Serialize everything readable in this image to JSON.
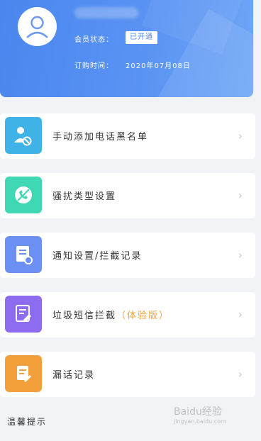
{
  "header": {
    "status_label": "会员状态：",
    "status_badge": "已开通",
    "order_label": "订购时间：",
    "order_date": "2020年07月08日"
  },
  "menu": [
    {
      "label": "手动添加电话黑名单",
      "icon": "user-block-icon",
      "color": "#3fb2e8"
    },
    {
      "label": "骚扰类型设置",
      "icon": "block-phone-icon",
      "color": "#3fd7b4"
    },
    {
      "label": "通知设置/拦截记录",
      "icon": "notify-record-icon",
      "color": "#6c8ff3"
    },
    {
      "label": "垃圾短信拦截",
      "suffix": "（体验版）",
      "icon": "sms-filter-icon",
      "color": "#8e6cf0"
    },
    {
      "label": "漏话记录",
      "icon": "missed-call-icon",
      "color": "#f3a03c"
    }
  ],
  "tips": "温馨提示",
  "watermark": {
    "brand": "Baidu经验",
    "url": "jingyan.baidu.com"
  }
}
